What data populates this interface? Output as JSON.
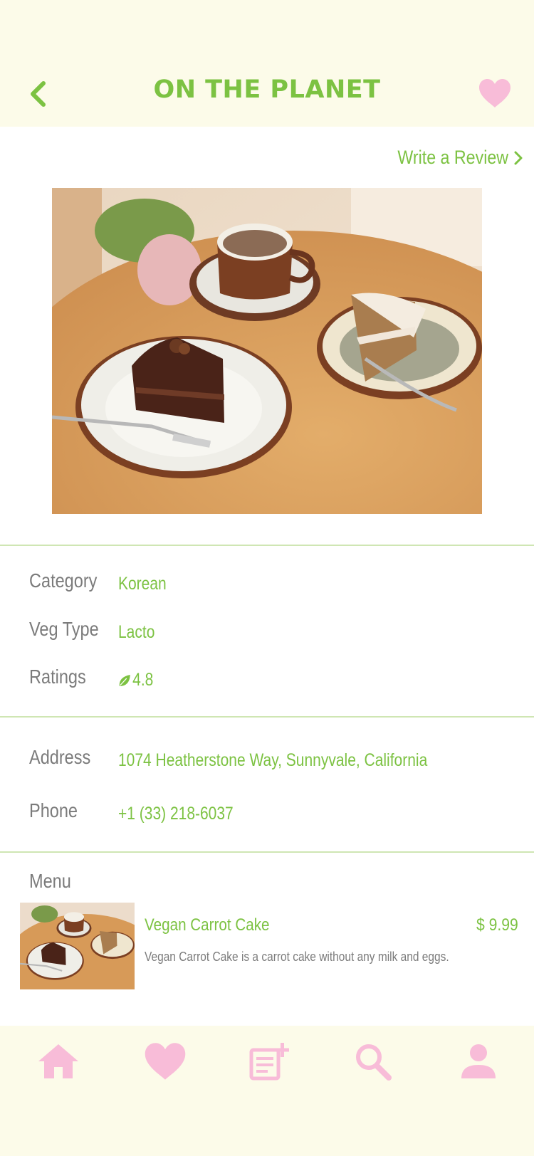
{
  "header": {
    "title": "ON THE PLANET",
    "back_icon": "chevron-left-icon",
    "favorite_icon": "heart-icon"
  },
  "write_review": {
    "label": "Write a Review",
    "icon": "chevron-right-icon"
  },
  "hero_image": {
    "subject": "chocolate-cake-and-carrot-cake-photo"
  },
  "details": {
    "category_label": "Category",
    "category_value": "Korean",
    "veg_type_label": "Veg Type",
    "veg_type_value": "Lacto",
    "ratings_label": "Ratings",
    "ratings_value": "4.8",
    "ratings_icon": "leaf-icon"
  },
  "contact": {
    "address_label": "Address",
    "address_value": "1074 Heatherstone Way, Sunnyvale, California",
    "phone_label": "Phone",
    "phone_value": "+1 (33) 218-6037"
  },
  "menu": {
    "label": "Menu",
    "items": [
      {
        "name": "Vegan Carrot Cake",
        "price": "$ 9.99",
        "description": "Vegan Carrot Cake is a carrot cake without any milk and eggs."
      }
    ]
  },
  "bottom_nav": {
    "items": [
      "home-icon",
      "heart-icon",
      "note-add-icon",
      "search-icon",
      "person-icon"
    ]
  },
  "colors": {
    "accent_green": "#7cc242",
    "accent_pink": "#f8bcd8",
    "bar_background": "#fcfbe9",
    "label_gray": "#7b7b7b"
  }
}
